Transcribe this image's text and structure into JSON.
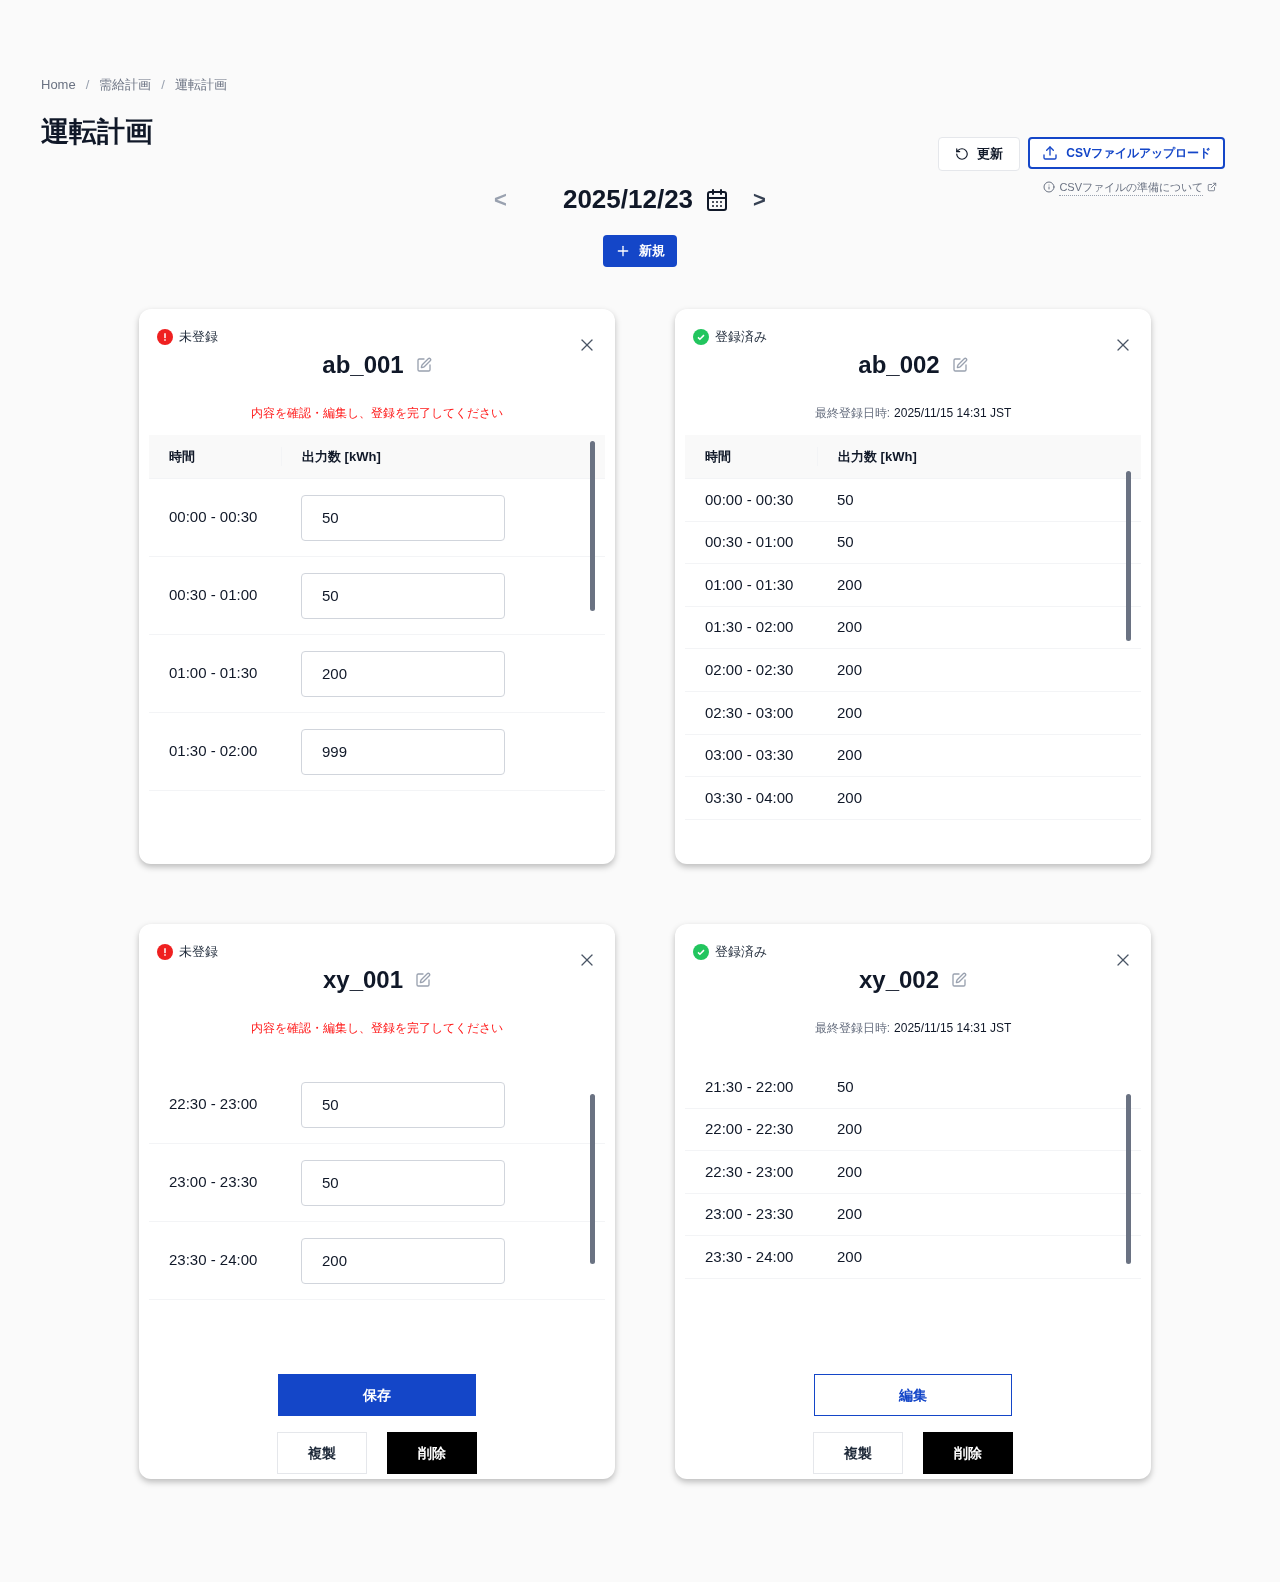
{
  "breadcrumb": [
    {
      "kind": "link",
      "text": "Home"
    },
    {
      "kind": "separator",
      "text": "/"
    },
    {
      "kind": "link",
      "text": "需給計画"
    },
    {
      "kind": "separator",
      "text": "/"
    },
    {
      "kind": "link",
      "text": "運転計画"
    }
  ],
  "page_title": "運転計画",
  "toolbar": {
    "refresh": "更新",
    "upload": "CSVファイルアップロード",
    "help_link": "CSVファイルの準備について"
  },
  "date_nav": {
    "prev": "<",
    "date": "2025/12/23",
    "next": ">",
    "new_button": "新規"
  },
  "cards": [
    {
      "kind": "unregistered",
      "status": "未登録",
      "name": "ab_001",
      "message": "内容を確認・編集し、登録を完了してください",
      "editable": true,
      "columns": [
        "時間",
        "出力数 [kWh]"
      ],
      "rows": [
        {
          "time": "00:00 - 00:30",
          "value": "50"
        },
        {
          "time": "00:30 - 01:00",
          "value": "50"
        },
        {
          "time": "01:00 - 01:30",
          "value": "200"
        },
        {
          "time": "01:30 - 02:00",
          "value": "999"
        }
      ]
    },
    {
      "kind": "registered",
      "status": "登録済み",
      "name": "ab_002",
      "registered_label": "最終登録日時:",
      "registered_at": "2025/11/15 14:31 JST",
      "editable": false,
      "columns": [
        "時間",
        "出力数 [kWh]"
      ],
      "rows": [
        {
          "time": "00:00 - 00:30",
          "value": "50"
        },
        {
          "time": "00:30 - 01:00",
          "value": "50"
        },
        {
          "time": "01:00 - 01:30",
          "value": "200"
        },
        {
          "time": "01:30 - 02:00",
          "value": "200"
        },
        {
          "time": "02:00 - 02:30",
          "value": "200"
        },
        {
          "time": "02:30 - 03:00",
          "value": "200"
        },
        {
          "time": "03:00 - 03:30",
          "value": "200"
        },
        {
          "time": "03:30 - 04:00",
          "value": "200"
        }
      ]
    },
    {
      "kind": "unregistered",
      "status": "未登録",
      "name": "xy_001",
      "message": "内容を確認・編集し、登録を完了してください",
      "editable": true,
      "rows": [
        {
          "time": "22:30 - 23:00",
          "value": "50"
        },
        {
          "time": "23:00 - 23:30",
          "value": "50"
        },
        {
          "time": "23:30 - 24:00",
          "value": "200"
        }
      ],
      "buttons": [
        {
          "label": "保存",
          "kind": "primary"
        },
        {
          "label": "複製",
          "kind": "secondary"
        },
        {
          "label": "削除",
          "kind": "danger"
        }
      ]
    },
    {
      "kind": "registered",
      "status": "登録済み",
      "name": "xy_002",
      "registered_label": "最終登録日時:",
      "registered_at": "2025/11/15 14:31 JST",
      "editable": false,
      "rows": [
        {
          "time": "21:30 - 22:00",
          "value": "50"
        },
        {
          "time": "22:00 - 22:30",
          "value": "200"
        },
        {
          "time": "22:30 - 23:00",
          "value": "200"
        },
        {
          "time": "23:00 - 23:30",
          "value": "200"
        },
        {
          "time": "23:30 - 24:00",
          "value": "200"
        }
      ],
      "buttons": [
        {
          "label": "編集",
          "kind": "outline"
        },
        {
          "label": "複製",
          "kind": "secondary"
        },
        {
          "label": "削除",
          "kind": "danger"
        }
      ]
    }
  ]
}
